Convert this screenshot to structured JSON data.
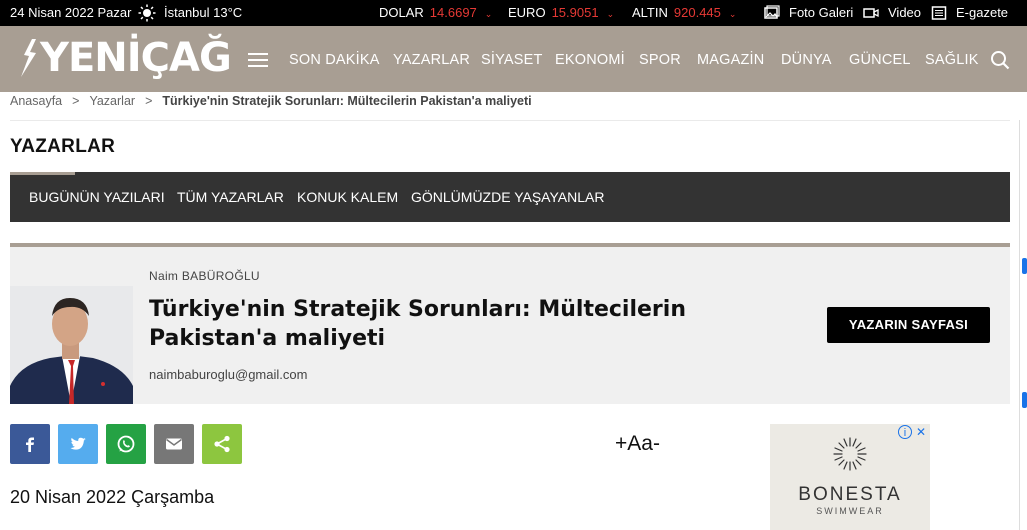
{
  "topbar": {
    "date": "24 Nisan 2022 Pazar",
    "weather_icon": "sun-icon",
    "weather": "İstanbul 13°C",
    "currencies": [
      {
        "name": "DOLAR",
        "value": "14.6697"
      },
      {
        "name": "EURO",
        "value": "15.9051"
      },
      {
        "name": "ALTIN",
        "value": "920.445"
      }
    ],
    "links": [
      {
        "label": "Foto Galeri",
        "icon": "photo-gallery-icon"
      },
      {
        "label": "Video",
        "icon": "video-icon"
      },
      {
        "label": "E-gazete",
        "icon": "newspaper-icon"
      }
    ]
  },
  "header": {
    "logo": "YENİÇAĞ",
    "nav": [
      "SON DAKİKA",
      "YAZARLAR",
      "SİYASET",
      "EKONOMİ",
      "SPOR",
      "MAGAZİN",
      "DÜNYA",
      "GÜNCEL",
      "SAĞLIK"
    ]
  },
  "breadcrumb": {
    "items": [
      "Anasayfa",
      "Yazarlar"
    ],
    "current": "Türkiye'nin Stratejik Sorunları: Mültecilerin Pakistan'a maliyeti",
    "separator": ">"
  },
  "section": {
    "title": "YAZARLAR",
    "tabs": [
      "BUGÜNÜN YAZILARI",
      "TÜM YAZARLAR",
      "KONUK KALEM",
      "GÖNLÜMÜZDE YAŞAYANLAR"
    ]
  },
  "author": {
    "name": "Naim BABÜROĞLU",
    "title": "Türkiye'nin Stratejik Sorunları: Mültecilerin Pakistan'a maliyeti",
    "email": "naimbaburoglu@gmail.com",
    "button": "YAZARIN SAYFASI"
  },
  "share": {
    "buttons": [
      {
        "name": "facebook",
        "color": "#3b5998"
      },
      {
        "name": "twitter",
        "color": "#55acee"
      },
      {
        "name": "whatsapp",
        "color": "#25a244"
      },
      {
        "name": "email",
        "color": "#777777"
      },
      {
        "name": "share",
        "color": "#8dc63f"
      }
    ],
    "font_size_label": "+Aa-"
  },
  "article": {
    "date": "20 Nisan 2022 Çarşamba"
  },
  "ad": {
    "brand": "BONESTA",
    "sub": "SWIMWEAR",
    "close": "✕",
    "info": "i"
  },
  "colors": {
    "header_bg": "#a89e93",
    "topbar_bg": "#000000",
    "accent_red": "#e53935",
    "subnav_bg": "#333333"
  }
}
